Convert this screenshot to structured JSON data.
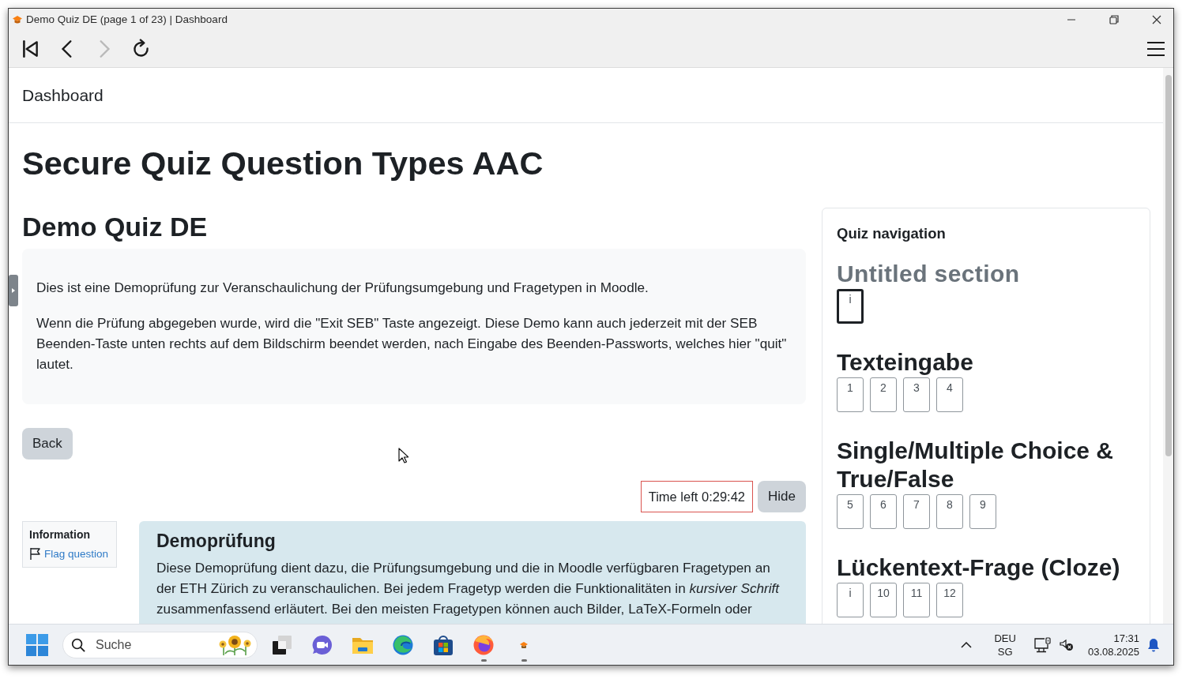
{
  "window": {
    "title": "Demo Quiz DE (page 1 of 23) | Dashboard"
  },
  "toolbar": {
    "buttons": [
      {
        "kind": "first",
        "disabled": false
      },
      {
        "kind": "back",
        "disabled": false
      },
      {
        "kind": "forward",
        "disabled": true
      },
      {
        "kind": "reload",
        "disabled": false
      }
    ]
  },
  "breadcrumb": "Dashboard",
  "page_title": "Secure Quiz Question Types AAC",
  "quiz_title": "Demo Quiz DE",
  "intro": [
    "Dies ist eine Demoprüfung zur Veranschaulichung der Prüfungsumgebung und Fragetypen in Moodle.",
    "Wenn die Prüfung abgegeben wurde, wird die \"Exit SEB\" Taste angezeigt. Diese Demo kann auch jederzeit mit der SEB Beenden-Taste unten rechts auf dem Bildschirm beendet werden, nach Eingabe des Beenden-Passworts, welches hier \"quit\" lautet."
  ],
  "back_button": "Back",
  "timer": {
    "text": "Time left 0:29:42",
    "hide_button": "Hide"
  },
  "question_info": {
    "label": "Information",
    "flag_link": "Flag question"
  },
  "question": {
    "title": "Demoprüfung",
    "text": "Diese Demoprüfung dient dazu, die Prüfungsumgebung und die in Moodle verfügbaren Fragetypen an der ETH Zürich zu veranschaulichen. Bei jedem Fragetyp werden die Funktionalitäten in *kursiver Schrift* zusammenfassend erläutert. Bei den meisten Fragetypen können auch Bilder, LaTeX-Formeln oder"
  },
  "quiz_navigation": {
    "title": "Quiz navigation",
    "sections": [
      {
        "heading": "Untitled section",
        "muted": true,
        "buttons": [
          {
            "label": "i",
            "current": true
          }
        ]
      },
      {
        "heading": "Texteingabe",
        "muted": false,
        "buttons": [
          {
            "label": "1",
            "current": false
          },
          {
            "label": "2",
            "current": false
          },
          {
            "label": "3",
            "current": false
          },
          {
            "label": "4",
            "current": false
          }
        ]
      },
      {
        "heading": "Single/Multiple Choice & True/False",
        "muted": false,
        "buttons": [
          {
            "label": "5",
            "current": false
          },
          {
            "label": "6",
            "current": false
          },
          {
            "label": "7",
            "current": false
          },
          {
            "label": "8",
            "current": false
          },
          {
            "label": "9",
            "current": false
          }
        ]
      },
      {
        "heading": "Lückentext-Frage (Cloze)",
        "muted": false,
        "buttons": [
          {
            "label": "i",
            "current": false
          },
          {
            "label": "10",
            "current": false
          },
          {
            "label": "11",
            "current": false
          },
          {
            "label": "12",
            "current": false
          }
        ]
      }
    ]
  },
  "taskbar": {
    "search_placeholder": "Suche",
    "apps": [
      {
        "kind": "tasks",
        "running": false
      },
      {
        "kind": "chat",
        "running": false
      },
      {
        "kind": "folder",
        "running": false
      },
      {
        "kind": "swirl",
        "running": false
      },
      {
        "kind": "store",
        "running": false
      },
      {
        "kind": "fox",
        "running": true
      },
      {
        "kind": "exam",
        "running": true
      }
    ],
    "tray": {
      "language": "DEU",
      "layout": "SG",
      "time": "17:31",
      "date": "03.08.2025"
    }
  }
}
